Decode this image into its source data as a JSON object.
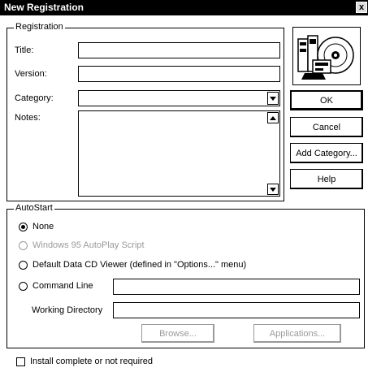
{
  "window": {
    "title": "New Registration",
    "close_glyph": "x"
  },
  "registration": {
    "legend": "Registration",
    "title_label": "Title:",
    "title_value": "",
    "version_label": "Version:",
    "version_value": "",
    "category_label": "Category:",
    "category_value": "",
    "notes_label": "Notes:",
    "notes_value": ""
  },
  "buttons": {
    "ok": "OK",
    "cancel": "Cancel",
    "add_category": "Add Category...",
    "help": "Help"
  },
  "autostart": {
    "legend": "AutoStart",
    "options": [
      {
        "label": "None",
        "checked": true,
        "enabled": true
      },
      {
        "label": "Windows 95 AutoPlay Script",
        "checked": false,
        "enabled": false
      },
      {
        "label": "Default Data CD Viewer (defined in \"Options...\" menu)",
        "checked": false,
        "enabled": true
      },
      {
        "label": "Command Line",
        "checked": false,
        "enabled": true
      }
    ],
    "command_line_value": "",
    "working_directory_label": "Working Directory",
    "working_directory_value": "",
    "browse_label": "Browse...",
    "applications_label": "Applications..."
  },
  "install_checkbox": {
    "label": "Install complete or not required",
    "checked": false
  },
  "icons": {
    "app_icon": "cd-registration-icon"
  }
}
